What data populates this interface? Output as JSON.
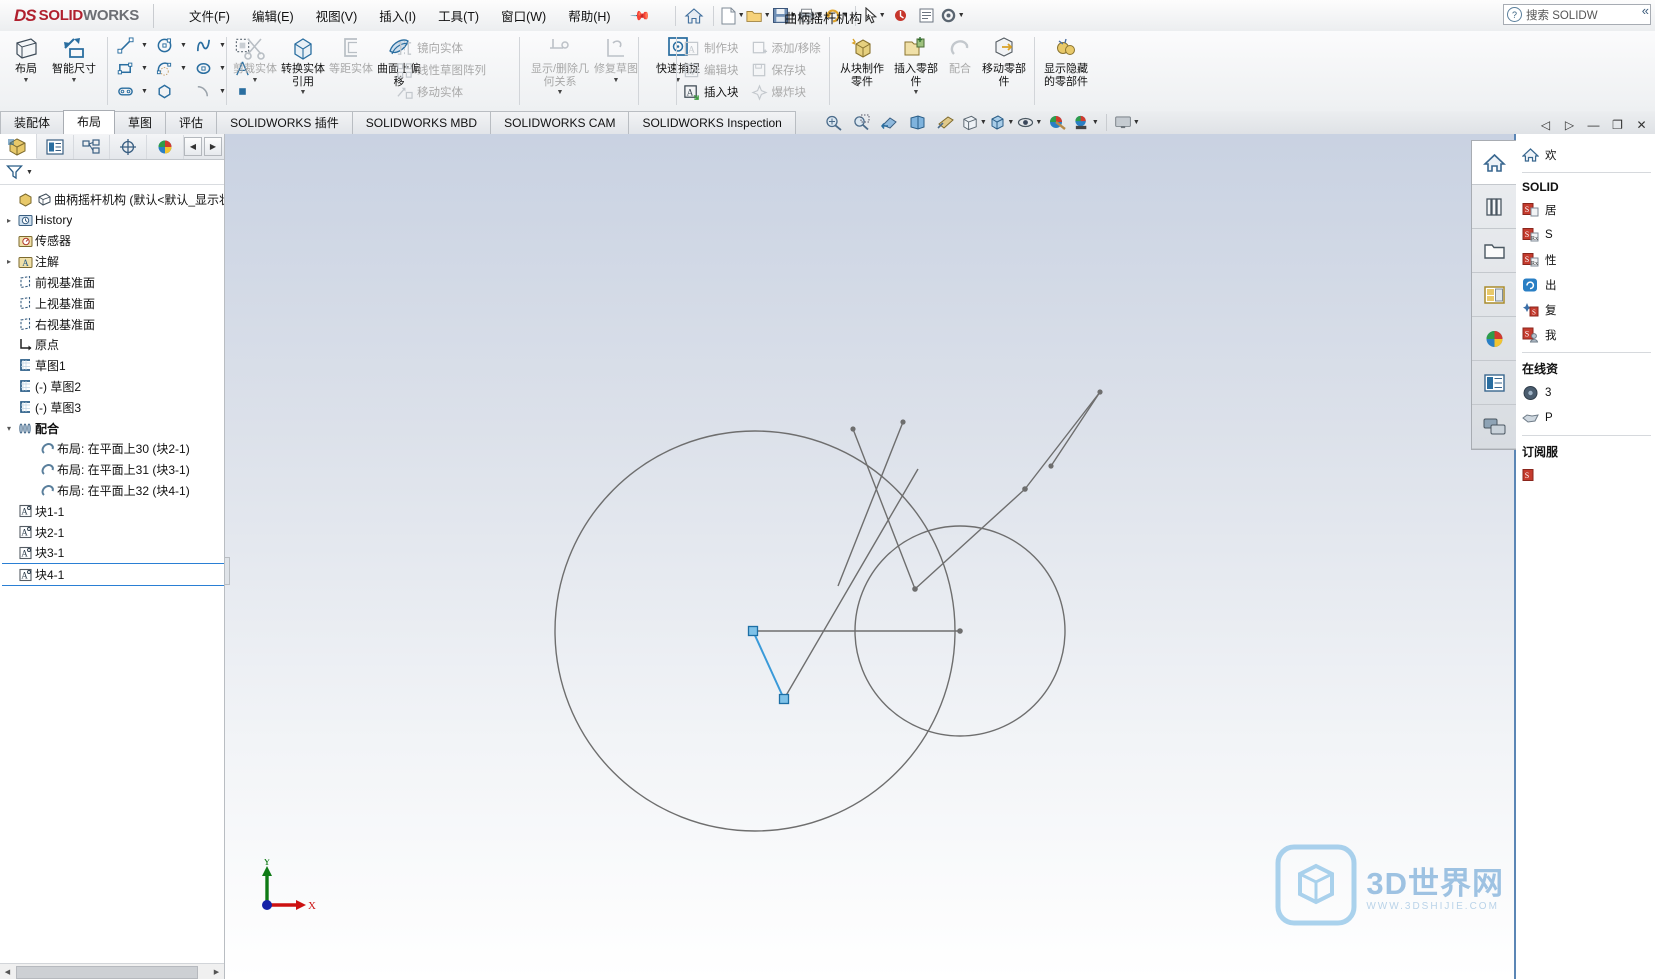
{
  "titlebar": {
    "brand_ds": "DS",
    "brand_solid": "SOLID",
    "brand_works": "WORKS",
    "menus": [
      {
        "label": "文件(F)",
        "name": "menu-file"
      },
      {
        "label": "编辑(E)",
        "name": "menu-edit"
      },
      {
        "label": "视图(V)",
        "name": "menu-view"
      },
      {
        "label": "插入(I)",
        "name": "menu-insert"
      },
      {
        "label": "工具(T)",
        "name": "menu-tools"
      },
      {
        "label": "窗口(W)",
        "name": "menu-window"
      },
      {
        "label": "帮助(H)",
        "name": "menu-help"
      }
    ],
    "pin_icon": "pin-icon",
    "document_title": "曲柄摇杆机构 *",
    "quick_access": [
      {
        "name": "home-icon",
        "glyph": "home"
      },
      {
        "name": "new-document-icon",
        "glyph": "new",
        "caret": false
      },
      {
        "name": "open-document-icon",
        "glyph": "open",
        "caret": true
      },
      {
        "name": "save-icon",
        "glyph": "save",
        "caret": true
      },
      {
        "name": "print-icon",
        "glyph": "print",
        "caret": true
      },
      {
        "name": "undo-icon",
        "glyph": "undo",
        "caret": true
      },
      {
        "name": "select-icon",
        "glyph": "select",
        "caret": true
      },
      {
        "name": "rebuild-icon",
        "glyph": "rebuild",
        "caret": false
      },
      {
        "name": "drawing-icon",
        "glyph": "drawing",
        "caret": false
      },
      {
        "name": "options-icon",
        "glyph": "gear",
        "caret": true
      }
    ],
    "search_placeholder": "搜索 SOLIDWORKS 帮助",
    "search_value": "搜索 SOLIDW"
  },
  "ribbon": {
    "groups": [
      {
        "name": "layout-group",
        "buttons": [
          {
            "label": "布局",
            "icon": "layout-icon",
            "name": "ribbon-layout",
            "dim": false,
            "dropdown": true
          },
          {
            "label": "智能尺寸",
            "icon": "smart-dimension-icon",
            "name": "ribbon-smart-dimension",
            "dim": false,
            "dropdown": true
          }
        ]
      },
      {
        "name": "sketch-entities-group",
        "rows": [
          [
            {
              "icon": "line-icon",
              "name": "sketch-line",
              "caret": true
            },
            {
              "icon": "circle-icon",
              "name": "sketch-circle",
              "caret": true
            },
            {
              "icon": "spline-icon",
              "name": "sketch-spline",
              "caret": true
            },
            {
              "icon": "trim-dashed-icon",
              "name": "sketch-select-area",
              "caret": false
            }
          ],
          [
            {
              "icon": "rectangle-icon",
              "name": "sketch-rectangle",
              "caret": true
            },
            {
              "icon": "arc-slot-icon",
              "name": "sketch-slot",
              "caret": true
            },
            {
              "icon": "ellipse-icon",
              "name": "sketch-ellipse",
              "caret": true
            },
            {
              "icon": "text-a-icon",
              "name": "sketch-text",
              "caret": false
            }
          ],
          [
            {
              "icon": "slot-icon",
              "name": "sketch-straight-slot",
              "caret": true
            },
            {
              "icon": "polygon-icon",
              "name": "sketch-polygon",
              "caret": false
            },
            {
              "icon": "fillet-icon",
              "name": "sketch-fillet",
              "caret": true
            },
            {
              "icon": "point-icon",
              "name": "sketch-point",
              "caret": false
            }
          ]
        ]
      },
      {
        "name": "modify-group",
        "buttons": [
          {
            "label": "剪裁实体",
            "icon": "trim-entities-icon",
            "name": "ribbon-trim-entities",
            "dim": true,
            "dropdown": true
          },
          {
            "label": "转换实体引用",
            "icon": "convert-entities-icon",
            "name": "ribbon-convert-entities",
            "dim": false,
            "dropdown": true
          },
          {
            "label": "等距实体",
            "icon": "offset-entities-icon",
            "name": "ribbon-offset-entities",
            "dim": true,
            "dropdown": false
          },
          {
            "label": "曲面上偏移",
            "icon": "offset-on-surface-icon",
            "name": "ribbon-offset-on-surface",
            "dim": false,
            "dropdown": false
          }
        ]
      },
      {
        "name": "pattern-group",
        "items": [
          {
            "label": "镜向实体",
            "icon": "mirror-entities-icon",
            "name": "ribbon-mirror-entities",
            "dim": true
          },
          {
            "label": "线性草图阵列",
            "icon": "linear-pattern-icon",
            "name": "ribbon-linear-sketch-pattern",
            "dim": true
          },
          {
            "label": "移动实体",
            "icon": "move-entities-icon",
            "name": "ribbon-move-entities",
            "dim": true
          }
        ]
      },
      {
        "name": "relations-group",
        "buttons": [
          {
            "label": "显示/删除几何关系",
            "icon": "display-delete-relations-icon",
            "name": "ribbon-display-delete-relations",
            "dim": true,
            "dropdown": true
          },
          {
            "label": "修复草图",
            "icon": "repair-sketch-icon",
            "name": "ribbon-repair-sketch",
            "dim": true,
            "dropdown": true
          },
          {
            "label": "快速捕捉",
            "icon": "quick-snaps-icon",
            "name": "ribbon-quick-snaps",
            "dim": false,
            "dropdown": true
          }
        ]
      },
      {
        "name": "blocks-group",
        "items": [
          {
            "label": "制作块",
            "icon": "make-block-icon",
            "name": "ribbon-make-block",
            "dim": true
          },
          {
            "label": "编辑块",
            "icon": "edit-block-icon",
            "name": "ribbon-edit-block",
            "dim": true
          },
          {
            "label": "插入块",
            "icon": "insert-block-icon",
            "name": "ribbon-insert-block",
            "dim": false
          },
          {
            "label": "添加/移除",
            "icon": "add-remove-icon",
            "name": "ribbon-add-remove",
            "dim": true
          },
          {
            "label": "保存块",
            "icon": "save-block-icon",
            "name": "ribbon-save-block",
            "dim": true
          },
          {
            "label": "爆炸块",
            "icon": "explode-block-icon",
            "name": "ribbon-explode-block",
            "dim": true
          }
        ]
      },
      {
        "name": "assembly-group",
        "buttons": [
          {
            "label": "从块制作零件",
            "icon": "make-part-from-block-icon",
            "name": "ribbon-make-part-from-block",
            "dim": false,
            "dropdown": false
          },
          {
            "label": "插入零部件",
            "icon": "insert-components-icon",
            "name": "ribbon-insert-components",
            "dim": false,
            "dropdown": true
          },
          {
            "label": "配合",
            "icon": "mate-icon",
            "name": "ribbon-mate",
            "dim": true,
            "dropdown": false
          },
          {
            "label": "移动零部件",
            "icon": "move-component-icon",
            "name": "ribbon-move-component",
            "dim": false,
            "dropdown": false
          },
          {
            "label": "显示隐藏的零部件",
            "icon": "show-hidden-components-icon",
            "name": "ribbon-show-hidden-components",
            "dim": false,
            "dropdown": false
          }
        ]
      }
    ],
    "collapse_icon": "collapse-ribbon-icon"
  },
  "tabs": [
    {
      "label": "装配体",
      "name": "tab-assembly",
      "active": false
    },
    {
      "label": "布局",
      "name": "tab-layout",
      "active": true
    },
    {
      "label": "草图",
      "name": "tab-sketch",
      "active": false
    },
    {
      "label": "评估",
      "name": "tab-evaluate",
      "active": false
    },
    {
      "label": "SOLIDWORKS 插件",
      "name": "tab-sw-addins",
      "active": false
    },
    {
      "label": "SOLIDWORKS MBD",
      "name": "tab-sw-mbd",
      "active": false
    },
    {
      "label": "SOLIDWORKS CAM",
      "name": "tab-sw-cam",
      "active": false
    },
    {
      "label": "SOLIDWORKS Inspection",
      "name": "tab-sw-inspection",
      "active": false
    }
  ],
  "view_toolbar": [
    {
      "name": "zoom-to-fit-icon",
      "caret": false
    },
    {
      "name": "zoom-to-area-icon",
      "caret": false
    },
    {
      "name": "previous-view-icon",
      "caret": false
    },
    {
      "name": "section-view-icon",
      "caret": false
    },
    {
      "name": "view-orientation-icon",
      "caret": false
    },
    {
      "name": "display-style-icon",
      "caret": true
    },
    {
      "name": "hide-show-items-icon",
      "caret": true
    },
    {
      "name": "apply-scene-icon",
      "caret": true
    },
    {
      "name": "edit-appearance-icon",
      "caret": false
    },
    {
      "name": "view-settings-icon",
      "caret": true
    },
    {
      "name": "viewport-icon",
      "caret": true
    }
  ],
  "window_buttons": [
    {
      "name": "restore-left-icon",
      "glyph": "◁"
    },
    {
      "name": "restore-right-icon",
      "glyph": "▷"
    },
    {
      "name": "minimize-window-button",
      "glyph": "—"
    },
    {
      "name": "restore-window-button",
      "glyph": "❐"
    },
    {
      "name": "close-window-button",
      "glyph": "✕"
    }
  ],
  "feature_manager": {
    "tabs": [
      {
        "name": "feature-manager-tab",
        "icon": "feature-tree-icon",
        "active": true
      },
      {
        "name": "property-manager-tab",
        "icon": "property-manager-icon",
        "active": false
      },
      {
        "name": "configuration-manager-tab",
        "icon": "configuration-icon",
        "active": false
      },
      {
        "name": "dimxpert-manager-tab",
        "icon": "dimxpert-icon",
        "active": false
      },
      {
        "name": "display-manager-tab",
        "icon": "display-manager-icon",
        "active": false
      }
    ],
    "nav_prev": "◀",
    "nav_next": "▶",
    "filter_icon": "filter-icon",
    "tree": [
      {
        "label": "曲柄摇杆机构  (默认<默认_显示状态",
        "icon": "assembly-icon",
        "indent": 0,
        "arrow": "",
        "name": "tree-item-assembly-root",
        "bold": false
      },
      {
        "label": "History",
        "icon": "history-icon",
        "indent": 1,
        "arrow": "▸",
        "name": "tree-item-history"
      },
      {
        "label": "传感器",
        "icon": "sensors-icon",
        "indent": 1,
        "arrow": "",
        "name": "tree-item-sensors"
      },
      {
        "label": "注解",
        "icon": "annotations-icon",
        "indent": 1,
        "arrow": "▸",
        "name": "tree-item-annotations"
      },
      {
        "label": "前视基准面",
        "icon": "plane-icon",
        "indent": 1,
        "arrow": "",
        "name": "tree-item-front-plane"
      },
      {
        "label": "上视基准面",
        "icon": "plane-icon",
        "indent": 1,
        "arrow": "",
        "name": "tree-item-top-plane"
      },
      {
        "label": "右视基准面",
        "icon": "plane-icon",
        "indent": 1,
        "arrow": "",
        "name": "tree-item-right-plane"
      },
      {
        "label": "原点",
        "icon": "origin-icon",
        "indent": 1,
        "arrow": "",
        "name": "tree-item-origin"
      },
      {
        "label": "草图1",
        "icon": "sketch-icon",
        "indent": 1,
        "arrow": "",
        "name": "tree-item-sketch1"
      },
      {
        "label": "(-) 草图2",
        "icon": "sketch-icon",
        "indent": 1,
        "arrow": "",
        "name": "tree-item-sketch2"
      },
      {
        "label": "(-) 草图3",
        "icon": "sketch-icon",
        "indent": 1,
        "arrow": "",
        "name": "tree-item-sketch3"
      },
      {
        "label": "配合",
        "icon": "mates-folder-icon",
        "indent": 1,
        "arrow": "▾",
        "name": "tree-item-mates-folder"
      },
      {
        "label": "布局: 在平面上30 (块2-1)",
        "icon": "mate-coincident-icon",
        "indent": 2,
        "arrow": "",
        "name": "tree-item-mate-30"
      },
      {
        "label": "布局: 在平面上31 (块3-1)",
        "icon": "mate-coincident-icon",
        "indent": 2,
        "arrow": "",
        "name": "tree-item-mate-31"
      },
      {
        "label": "布局: 在平面上32 (块4-1)",
        "icon": "mate-coincident-icon",
        "indent": 2,
        "arrow": "",
        "name": "tree-item-mate-32"
      },
      {
        "label": "块1-1",
        "icon": "block-icon",
        "indent": 1,
        "arrow": "",
        "name": "tree-item-block1-1"
      },
      {
        "label": "块2-1",
        "icon": "block-icon",
        "indent": 1,
        "arrow": "",
        "name": "tree-item-block2-1"
      },
      {
        "label": "块3-1",
        "icon": "block-icon",
        "indent": 1,
        "arrow": "",
        "name": "tree-item-block3-1"
      },
      {
        "label": "块4-1",
        "icon": "block-icon",
        "indent": 1,
        "arrow": "",
        "name": "tree-item-block4-1",
        "selected": true
      }
    ]
  },
  "graphics": {
    "triad": {
      "x_label": "X",
      "y_label": "Y",
      "x_color": "#cc1111",
      "y_color": "#0e7a15",
      "origin_color": "#1622a8"
    },
    "selected_color": "#3a9ad9",
    "geometry_color": "#6e6e6e",
    "watermark_main": "3D世界网",
    "watermark_sub": "WWW.3DSHIJIE.COM"
  },
  "task_pane": {
    "tabs": [
      {
        "name": "task-pane-resources-tab",
        "icon": "home-icon",
        "active": true
      },
      {
        "name": "task-pane-design-library-tab",
        "icon": "library-icon",
        "active": false
      },
      {
        "name": "task-pane-file-explorer-tab",
        "icon": "folder-icon",
        "active": false
      },
      {
        "name": "task-pane-view-palette-tab",
        "icon": "view-palette-icon",
        "active": false
      },
      {
        "name": "task-pane-appearances-tab",
        "icon": "appearances-icon",
        "active": false
      },
      {
        "name": "task-pane-custom-properties-tab",
        "icon": "custom-properties-icon",
        "active": false
      },
      {
        "name": "task-pane-forum-tab",
        "icon": "forum-icon",
        "active": false
      }
    ],
    "welcome_label": "欢",
    "section_solidworks": "SOLID",
    "links": [
      {
        "label": "居",
        "icon": "sw-doc-icon",
        "name": "task-pane-link-1"
      },
      {
        "label": "S",
        "icon": "sw-rx-icon",
        "name": "task-pane-link-2"
      },
      {
        "label": "性",
        "icon": "sw-rx-icon",
        "name": "task-pane-link-3"
      },
      {
        "label": "出",
        "icon": "sync-icon",
        "name": "task-pane-link-4"
      },
      {
        "label": "复",
        "icon": "sw-star-icon",
        "name": "task-pane-link-5"
      },
      {
        "label": "我",
        "icon": "sw-user-icon",
        "name": "task-pane-link-6"
      }
    ],
    "section_online": "在线资",
    "online_links": [
      {
        "label": "3",
        "icon": "3d-content-icon",
        "name": "task-pane-online-1"
      },
      {
        "label": "P",
        "icon": "partner-icon",
        "name": "task-pane-online-2"
      }
    ],
    "section_subscription": "订阅服"
  },
  "scrollbar": {
    "left_arrow": "◀",
    "right_arrow": "▶"
  }
}
